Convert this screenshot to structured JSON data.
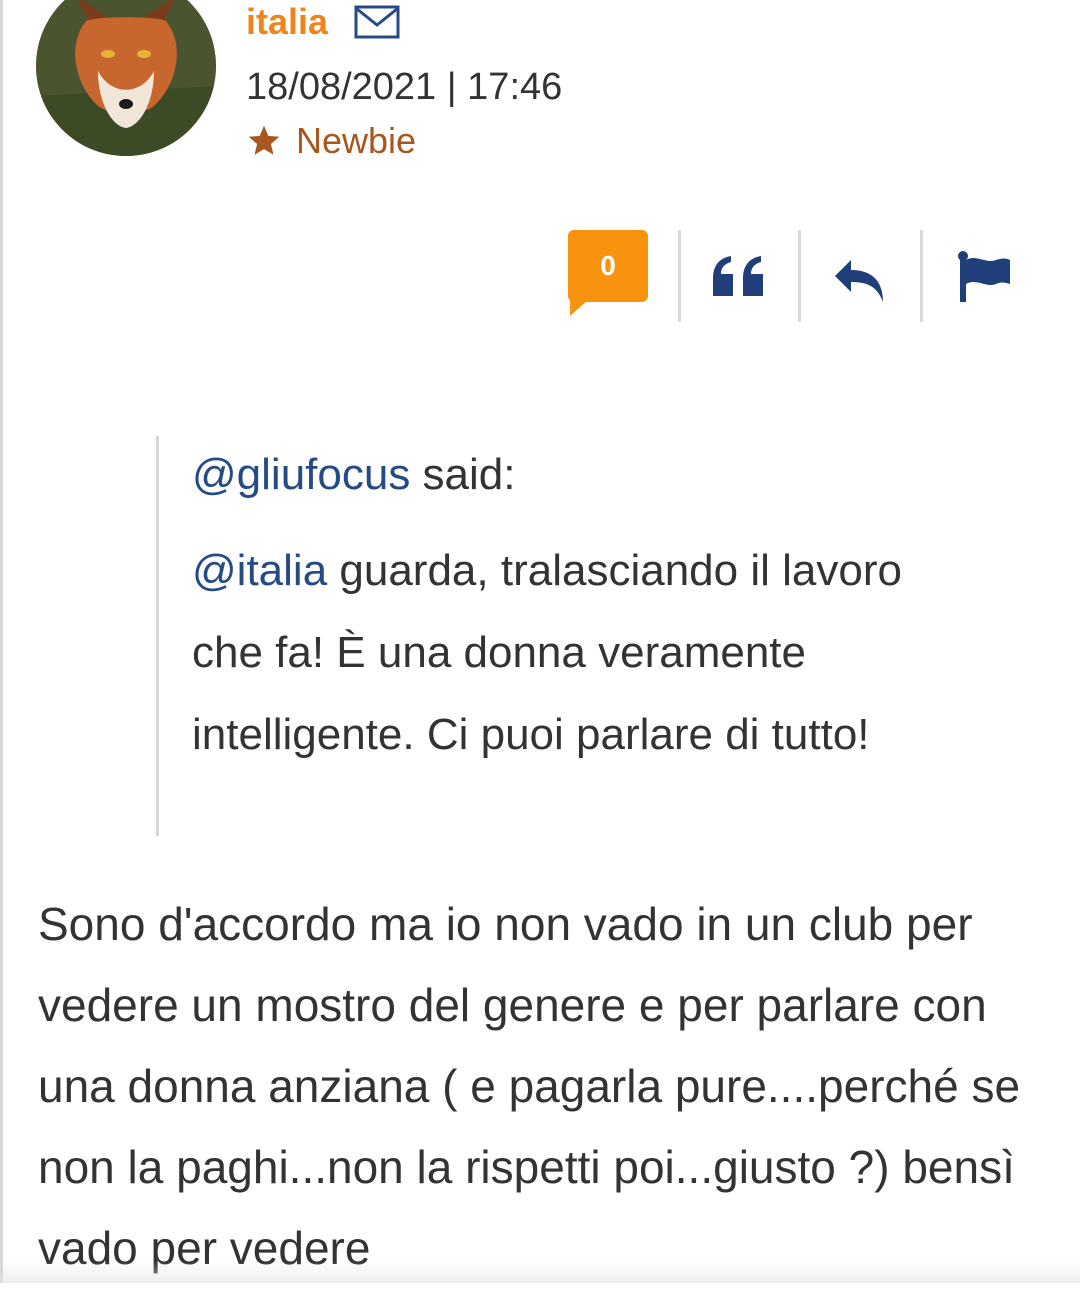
{
  "post": {
    "author": {
      "username": "italia",
      "datetime": "18/08/2021 | 17:46",
      "rank": "Newbie",
      "avatar_alt": "fox avatar"
    },
    "actions": {
      "likes_count": "0",
      "icons": [
        "quote-icon",
        "reply-icon",
        "flag-icon"
      ]
    },
    "quote": {
      "author_mention": "@gliufocus",
      "said_label": " said:",
      "mention": "@italia",
      "text": " guarda, tralasciando il lavoro che fa! È una donna veramente intelligente. Ci puoi parlare di tutto!"
    },
    "body": "Sono d'accordo ma io non vado in un club per vedere un mostro del genere e per parlare con una donna anziana ( e pagarla pure....perché se non la paghi...non la rispetti poi...giusto ?) bensì vado per vedere"
  },
  "colors": {
    "accent": "#f0841c",
    "rank": "#a8571f",
    "badge": "#f7930e",
    "link": "#254b86",
    "icon": "#1f3e7a"
  }
}
